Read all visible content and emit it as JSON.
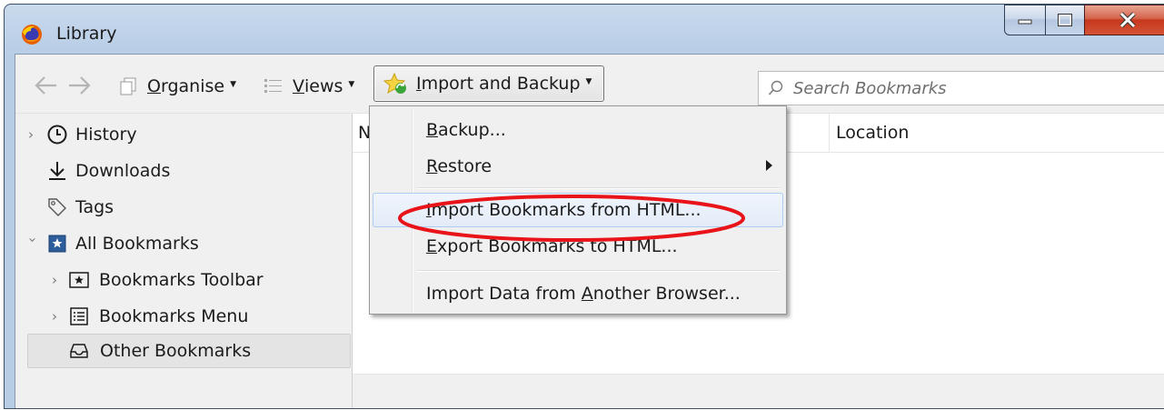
{
  "window": {
    "title": "Library"
  },
  "toolbar": {
    "organise_pre": "",
    "organise_ul": "O",
    "organise_rest": "rganise",
    "views_ul": "V",
    "views_rest": "iews",
    "import_ul": "I",
    "import_rest": "mport and Backup"
  },
  "search": {
    "placeholder": "Search Bookmarks"
  },
  "sidebar": {
    "items": [
      {
        "label": "History",
        "icon": "clock-icon"
      },
      {
        "label": "Downloads",
        "icon": "download-icon"
      },
      {
        "label": "Tags",
        "icon": "tag-icon"
      },
      {
        "label": "All Bookmarks",
        "icon": "bookmarks-star-icon"
      },
      {
        "label": "Bookmarks Toolbar",
        "icon": "toolbar-star-icon"
      },
      {
        "label": "Bookmarks Menu",
        "icon": "menu-list-icon"
      },
      {
        "label": "Other Bookmarks",
        "icon": "inbox-tray-icon"
      }
    ]
  },
  "columns": {
    "name": "N",
    "location": "Location"
  },
  "menu": {
    "backup_ul": "B",
    "backup_rest": "ackup...",
    "restore_ul": "R",
    "restore_rest": "estore",
    "import_ul": "I",
    "import_rest": "mport Bookmarks from HTML...",
    "export_ul": "E",
    "export_rest": "xport Bookmarks to HTML...",
    "importdata_pre": "Import Data from ",
    "importdata_ul": "A",
    "importdata_rest": "nother Browser..."
  },
  "colors": {
    "highlight_ellipse": "#e8141a",
    "accent": "#aecbf1"
  }
}
